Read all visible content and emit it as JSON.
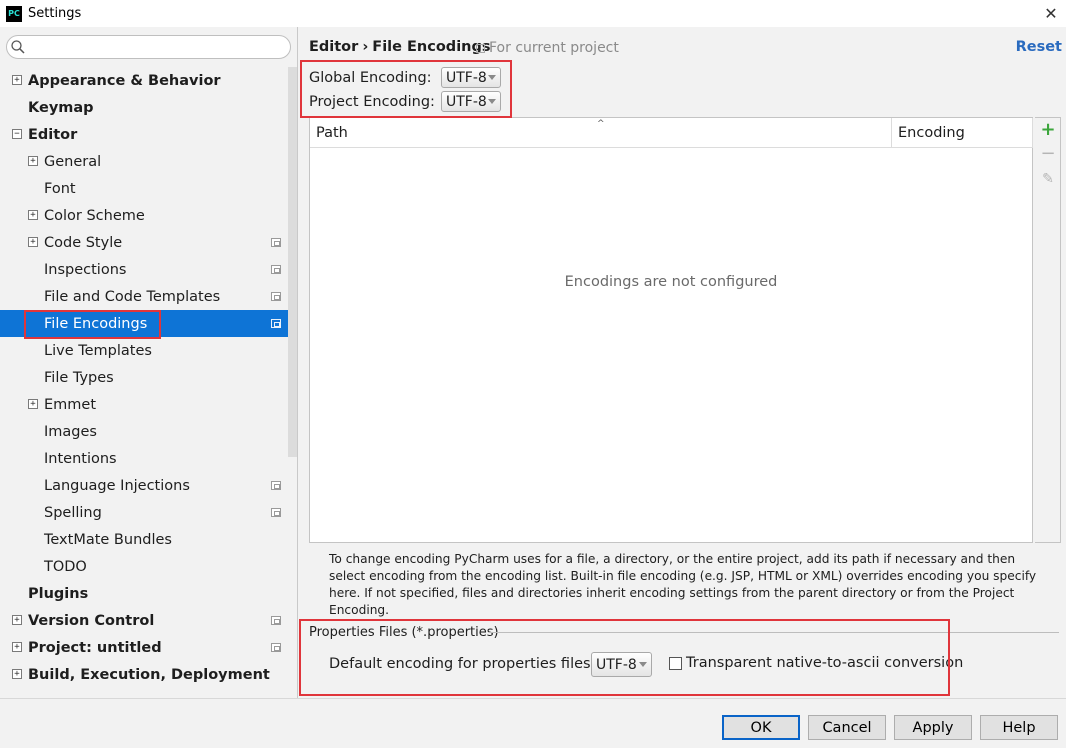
{
  "window": {
    "title": "Settings",
    "logo_text": "PC",
    "close_glyph": "✕"
  },
  "search": {
    "placeholder": "",
    "value": ""
  },
  "sidebar": {
    "items": [
      {
        "label": "Appearance & Behavior",
        "bold": true,
        "expander": "+",
        "level": 0,
        "project_icon": false
      },
      {
        "label": "Keymap",
        "bold": true,
        "expander": "",
        "level": 0,
        "project_icon": false
      },
      {
        "label": "Editor",
        "bold": true,
        "expander": "−",
        "level": 0,
        "project_icon": false
      },
      {
        "label": "General",
        "bold": false,
        "expander": "+",
        "level": 1,
        "project_icon": false
      },
      {
        "label": "Font",
        "bold": false,
        "expander": "",
        "level": 1,
        "project_icon": false
      },
      {
        "label": "Color Scheme",
        "bold": false,
        "expander": "+",
        "level": 1,
        "project_icon": false
      },
      {
        "label": "Code Style",
        "bold": false,
        "expander": "+",
        "level": 1,
        "project_icon": true
      },
      {
        "label": "Inspections",
        "bold": false,
        "expander": "",
        "level": 1,
        "project_icon": true
      },
      {
        "label": "File and Code Templates",
        "bold": false,
        "expander": "",
        "level": 1,
        "project_icon": true
      },
      {
        "label": "File Encodings",
        "bold": false,
        "expander": "",
        "level": 1,
        "project_icon": true,
        "selected": true
      },
      {
        "label": "Live Templates",
        "bold": false,
        "expander": "",
        "level": 1,
        "project_icon": false
      },
      {
        "label": "File Types",
        "bold": false,
        "expander": "",
        "level": 1,
        "project_icon": false
      },
      {
        "label": "Emmet",
        "bold": false,
        "expander": "+",
        "level": 1,
        "project_icon": false
      },
      {
        "label": "Images",
        "bold": false,
        "expander": "",
        "level": 1,
        "project_icon": false
      },
      {
        "label": "Intentions",
        "bold": false,
        "expander": "",
        "level": 1,
        "project_icon": false
      },
      {
        "label": "Language Injections",
        "bold": false,
        "expander": "",
        "level": 1,
        "project_icon": true
      },
      {
        "label": "Spelling",
        "bold": false,
        "expander": "",
        "level": 1,
        "project_icon": true
      },
      {
        "label": "TextMate Bundles",
        "bold": false,
        "expander": "",
        "level": 1,
        "project_icon": false
      },
      {
        "label": "TODO",
        "bold": false,
        "expander": "",
        "level": 1,
        "project_icon": false
      },
      {
        "label": "Plugins",
        "bold": true,
        "expander": "",
        "level": 0,
        "project_icon": false
      },
      {
        "label": "Version Control",
        "bold": true,
        "expander": "+",
        "level": 0,
        "project_icon": true
      },
      {
        "label": "Project: untitled",
        "bold": true,
        "expander": "+",
        "level": 0,
        "project_icon": true
      },
      {
        "label": "Build, Execution, Deployment",
        "bold": true,
        "expander": "+",
        "level": 0,
        "project_icon": false
      }
    ]
  },
  "header": {
    "crumb_parent": "Editor",
    "crumb_sep": "›",
    "crumb_current": "File Encodings",
    "scope": "For current project",
    "reset": "Reset"
  },
  "encodings": {
    "global_label": "Global Encoding:",
    "global_value": "UTF-8",
    "project_label": "Project Encoding:",
    "project_value": "UTF-8"
  },
  "table": {
    "col_path": "Path",
    "col_encoding": "Encoding",
    "empty": "Encodings are not configured",
    "sort_caret": "^"
  },
  "toolbar": {
    "add": "+",
    "remove": "−",
    "edit": "✎"
  },
  "help_text": "To change encoding PyCharm uses for a file, a directory, or the entire project, add its path if necessary and then select encoding from the encoding list. Built-in file encoding (e.g. JSP, HTML or XML) overrides encoding you specify here. If not specified, files and directories inherit encoding settings from the parent directory or from the Project Encoding.",
  "properties": {
    "group_title": "Properties Files (*.properties)",
    "default_label": "Default encoding for properties files:",
    "default_value": "UTF-8",
    "transparent_label": "Transparent native-to-ascii conversion",
    "transparent_checked": false
  },
  "buttons": {
    "ok": "OK",
    "cancel": "Cancel",
    "apply": "Apply",
    "help": "Help"
  },
  "colors": {
    "selection": "#0e74d6",
    "highlight_box": "#e0353b",
    "link": "#2a6bbf",
    "add_green": "#3ca63c"
  }
}
